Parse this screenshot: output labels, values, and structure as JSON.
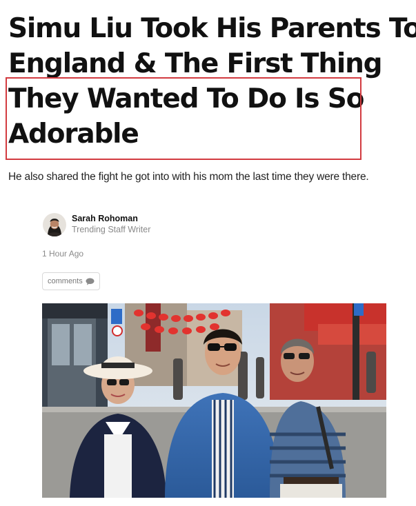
{
  "article": {
    "headline_lines": [
      "Simu Liu Took His Parents To",
      "England & The First Thing",
      "They Wanted To Do Is So",
      "Adorable"
    ],
    "subheadline": "He also shared the fight he got into with his mom the last time they were there."
  },
  "author": {
    "name": "Sarah Rohoman",
    "role": "Trending Staff Writer"
  },
  "meta": {
    "timestamp": "1 Hour Ago",
    "comments_label": "comments"
  },
  "icons": {
    "comments": "speech-bubble-icon"
  },
  "colors": {
    "highlight_border": "#d23a3f",
    "headline": "#111111",
    "muted_text": "#8a8a8a"
  }
}
